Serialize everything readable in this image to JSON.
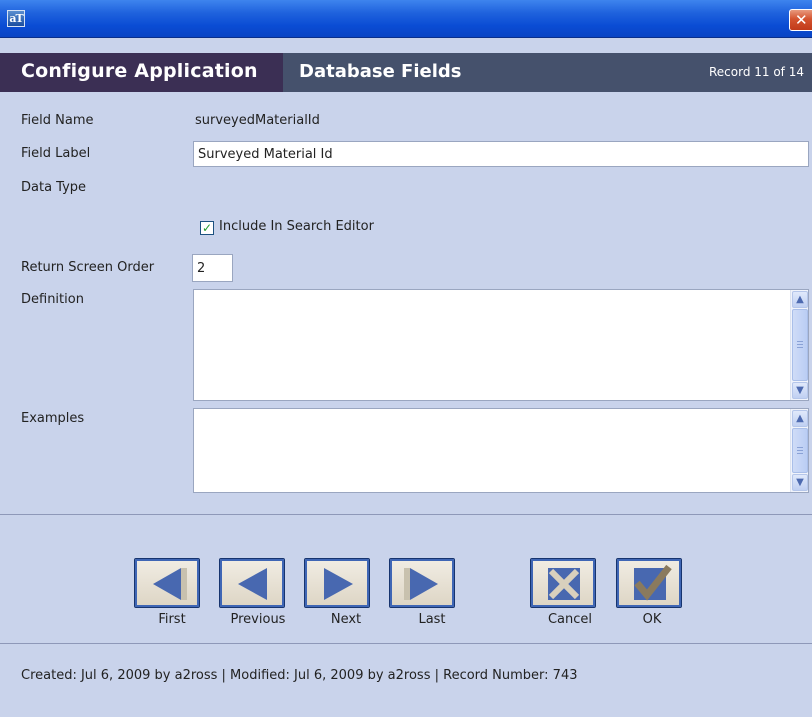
{
  "window": {
    "icon_text": "aT",
    "close_glyph": "✕"
  },
  "header": {
    "app_title": "Configure Application",
    "section_title": "Database Fields",
    "record_status": "Record 11 of 14"
  },
  "form": {
    "field_name_label": "Field Name",
    "field_name_value": "surveyedMaterialId",
    "field_label_label": "Field Label",
    "field_label_value": "Surveyed Material Id",
    "data_type_label": "Data Type",
    "include_search_label": "Include In Search Editor",
    "include_search_checked": true,
    "return_order_label": "Return Screen Order",
    "return_order_value": "2",
    "definition_label": "Definition",
    "definition_value": "",
    "examples_label": "Examples",
    "examples_value": ""
  },
  "nav": {
    "first": "First",
    "previous": "Previous",
    "next": "Next",
    "last": "Last",
    "cancel": "Cancel",
    "ok": "OK"
  },
  "footer": {
    "text": "Created: Jul 6, 2009 by a2ross | Modified: Jul 6, 2009 by a2ross | Record Number: 743"
  },
  "icons": {
    "first": "first-icon",
    "previous": "previous-icon",
    "next": "next-icon",
    "last": "last-icon",
    "cancel": "cancel-icon",
    "ok": "ok-icon",
    "scroll_up": "chevron-up-icon",
    "scroll_down": "chevron-down-icon"
  },
  "colors": {
    "header_bg": "#3b2f54",
    "section_bg": "#45516c",
    "form_bg": "#c9d3eb",
    "nav_icon": "#4868b0",
    "ok_check": "#8a7a5e"
  }
}
